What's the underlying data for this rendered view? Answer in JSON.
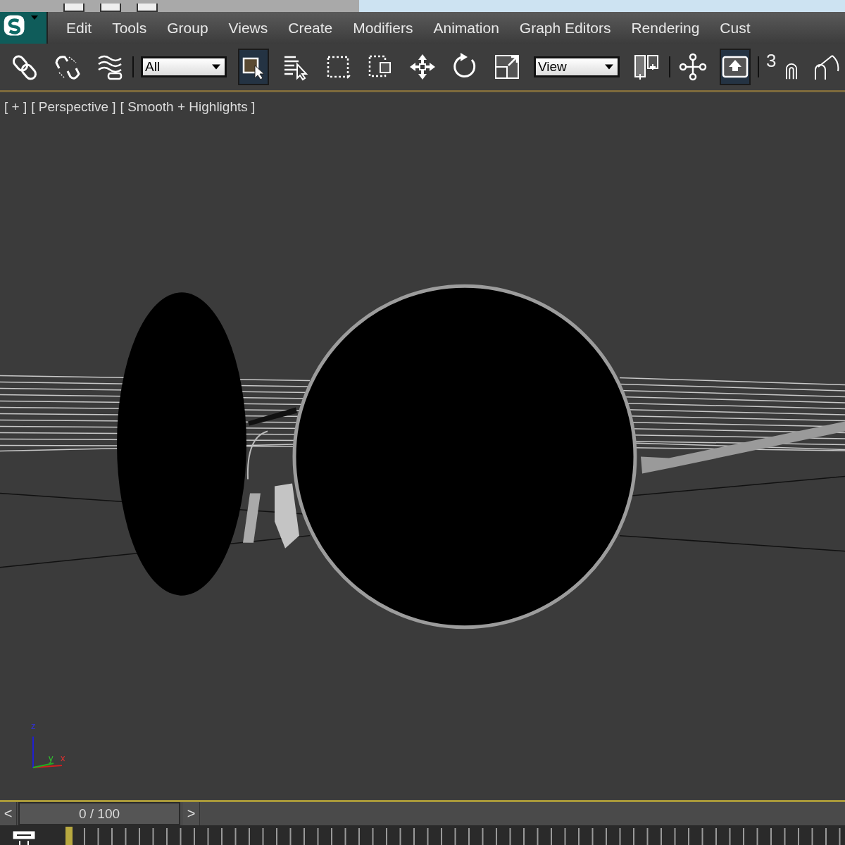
{
  "menu_bar": {
    "items": [
      "Edit",
      "Tools",
      "Group",
      "Views",
      "Create",
      "Modifiers",
      "Animation",
      "Graph Editors",
      "Rendering",
      "Cust"
    ]
  },
  "main_toolbar": {
    "items": [
      {
        "kind": "button",
        "selected": false
      },
      {
        "kind": "button",
        "selected": false
      },
      {
        "kind": "button",
        "selected": false
      },
      {
        "kind": "dropdown",
        "value": "All"
      },
      {
        "kind": "button",
        "selected": true
      },
      {
        "kind": "button",
        "selected": false
      },
      {
        "kind": "button",
        "selected": false
      },
      {
        "kind": "button",
        "selected": false
      },
      {
        "kind": "button",
        "selected": false
      },
      {
        "kind": "button",
        "selected": false
      },
      {
        "kind": "button",
        "selected": false
      },
      {
        "kind": "dropdown",
        "value": "View"
      },
      {
        "kind": "button",
        "selected": false
      },
      {
        "kind": "button",
        "selected": false
      },
      {
        "kind": "button",
        "selected": true
      },
      {
        "kind": "snap",
        "label": "3",
        "selected": false
      },
      {
        "kind": "button",
        "selected": false
      }
    ]
  },
  "viewport": {
    "labels": [
      "[ + ]",
      "[ Perspective ]",
      "[ Smooth + Highlights ]"
    ],
    "axis_labels": [
      "z",
      "y",
      "x"
    ]
  },
  "time_slider": {
    "previous": "<",
    "position": "0 / 100",
    "next": ">",
    "level": 0
  }
}
